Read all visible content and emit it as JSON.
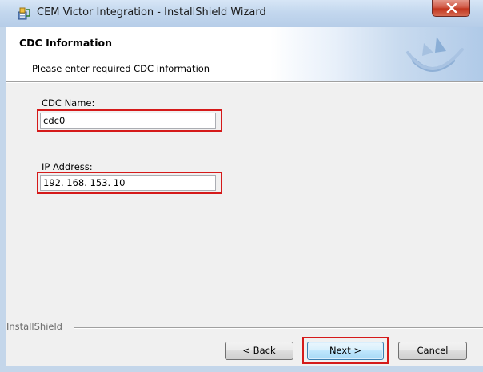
{
  "window": {
    "title": "CEM Victor Integration - InstallShield Wizard",
    "close_label": "x"
  },
  "header": {
    "title": "CDC Information",
    "subtitle": "Please enter required CDC information"
  },
  "form": {
    "cdc_name": {
      "label": "CDC Name:",
      "value": "cdc0"
    },
    "ip_address": {
      "label": "IP Address:",
      "value": "192. 168. 153. 10"
    }
  },
  "footer": {
    "brand": "InstallShield",
    "back_label": "< Back",
    "next_label": "Next >",
    "cancel_label": "Cancel"
  },
  "colors": {
    "highlight": "#d51a1a",
    "title_bar": "#c3d7ee",
    "close_button": "#c2361f",
    "dialog_background": "#f0f0f0"
  },
  "icons": [
    "installer-app-icon",
    "close-icon",
    "installshield-logo-icon"
  ]
}
